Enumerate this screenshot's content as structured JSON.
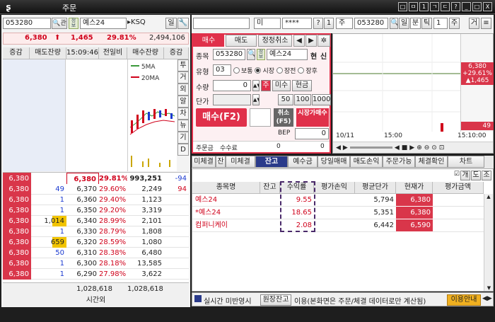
{
  "window": {
    "title": "주문",
    "buttons": [
      "□",
      "ㅁ",
      "1",
      "ㄱ",
      "ㄷ",
      "?",
      "_",
      "□",
      "X"
    ]
  },
  "left": {
    "code": "053280",
    "search_btn": "관",
    "name": "예스24",
    "market": "KSQ",
    "tag": "정보",
    "btn1": "일",
    "tool_icon": "wrench",
    "price": "6,380",
    "change": "1,465",
    "rate": "29.81%",
    "volume": "2,494,106",
    "headers": [
      "증감",
      "매도잔량",
      "15:09:46",
      "전일비",
      "매수잔량",
      "증감"
    ],
    "sell_rows": [],
    "ma_labels": [
      "5MA",
      "20MA"
    ],
    "vtabs": [
      "투",
      "거",
      "외",
      "알",
      "차",
      "뉴",
      "기",
      "D"
    ],
    "current": {
      "price": "6,380",
      "rate": "29.81%",
      "buy": "993,251",
      "delta": "-94"
    },
    "rows": [
      {
        "chg": "6,380",
        "sq": "49",
        "p": "6,370",
        "r": "29.60%",
        "bq": "2,249",
        "bd": "94"
      },
      {
        "chg": "6,380",
        "sq": "1",
        "p": "6,360",
        "r": "29.40%",
        "bq": "1,123",
        "bd": ""
      },
      {
        "chg": "6,380",
        "sq": "1",
        "p": "6,350",
        "r": "29.20%",
        "bq": "3,319",
        "bd": ""
      },
      {
        "chg": "6,380",
        "sq": "1,014",
        "p": "6,340",
        "r": "28.99%",
        "bq": "2,101",
        "bd": ""
      },
      {
        "chg": "6,380",
        "sq": "1",
        "p": "6,330",
        "r": "28.79%",
        "bq": "1,808",
        "bd": ""
      },
      {
        "chg": "6,380",
        "sq": "659",
        "p": "6,320",
        "r": "28.59%",
        "bq": "1,080",
        "bd": ""
      },
      {
        "chg": "6,380",
        "sq": "50",
        "p": "6,310",
        "r": "28.38%",
        "bq": "6,480",
        "bd": ""
      },
      {
        "chg": "6,380",
        "sq": "1",
        "p": "6,300",
        "r": "28.18%",
        "bq": "13,585",
        "bd": ""
      },
      {
        "chg": "6,380",
        "sq": "1",
        "p": "6,290",
        "r": "27.98%",
        "bq": "3,622",
        "bd": ""
      }
    ],
    "totals": {
      "sell": "1,028,618",
      "buy": "1,028,618",
      "after": "시간외"
    }
  },
  "right_top": {
    "sel1": "",
    "sel2": "미",
    "pw": "****",
    "btn_q": "?",
    "btn_1": "1",
    "sel3": "주",
    "code": "053280",
    "btn_il": "일",
    "btn_bun": "분",
    "btn_tick": "틱",
    "btn_1b": "1",
    "btn_ju": "주",
    "btn_geo": "거"
  },
  "order": {
    "tabs": [
      "매수",
      "매도",
      "정정취소"
    ],
    "code_label": "종목",
    "code": "053280",
    "tag": "정보",
    "name": "예스24",
    "cur_label": "현",
    "cur2": "신",
    "type_label": "유형",
    "type_code": "03",
    "radios": [
      "보통",
      "시장",
      "장전",
      "장후"
    ],
    "qty_label": "수량",
    "qty": "0",
    "main_btn": "주",
    "misu": "미수",
    "cash": "현금",
    "price_label": "단가",
    "amounts": [
      "50",
      "100",
      "1000"
    ],
    "buy_btn": "매수(F2)",
    "cancel_btn": "취소(F5)",
    "market_btn": "시장가매수",
    "bep_label": "BEP",
    "bep": "0",
    "order_amt_label": "주문금",
    "fee_label": "수수료",
    "fee": "0",
    "order_amt": "0"
  },
  "chart_mini": {
    "price": "6,380",
    "rate": "+29.61%",
    "change": "▲1,465",
    "vol": "49",
    "times": [
      "10/11",
      "15:00",
      "15:10:00"
    ]
  },
  "tabs2": [
    "미체결",
    "잔",
    "미체결",
    "잔고",
    "예수금",
    "당일매매",
    "매도손익",
    "주문가능",
    "체결확인",
    "차트"
  ],
  "holdings": {
    "columns": [
      "종목명",
      "잔고",
      "수익률",
      "평가손익",
      "평균단가",
      "현재가",
      "평가금액"
    ],
    "rows": [
      {
        "name": "예스24",
        "qty": "",
        "rate": "9.55",
        "pl": "",
        "avg": "5,794",
        "cur": "6,380",
        "amt": ""
      },
      {
        "name": "*예스24",
        "qty": "",
        "rate": "18.65",
        "pl": "",
        "avg": "5,351",
        "cur": "6,380",
        "amt": ""
      },
      {
        "name": "컴퍼니케이",
        "qty": "",
        "rate": "2.08",
        "pl": "",
        "avg": "6,442",
        "cur": "6,590",
        "amt": ""
      }
    ],
    "check_labels": [
      "개",
      "도",
      "조"
    ]
  },
  "status": {
    "checkbox_label": "실시간 미반영시",
    "btn": "원장잔고",
    "note": "이용(본화면은 주문/체결 데이터로만 계산됨)",
    "guide": "이용안내"
  }
}
